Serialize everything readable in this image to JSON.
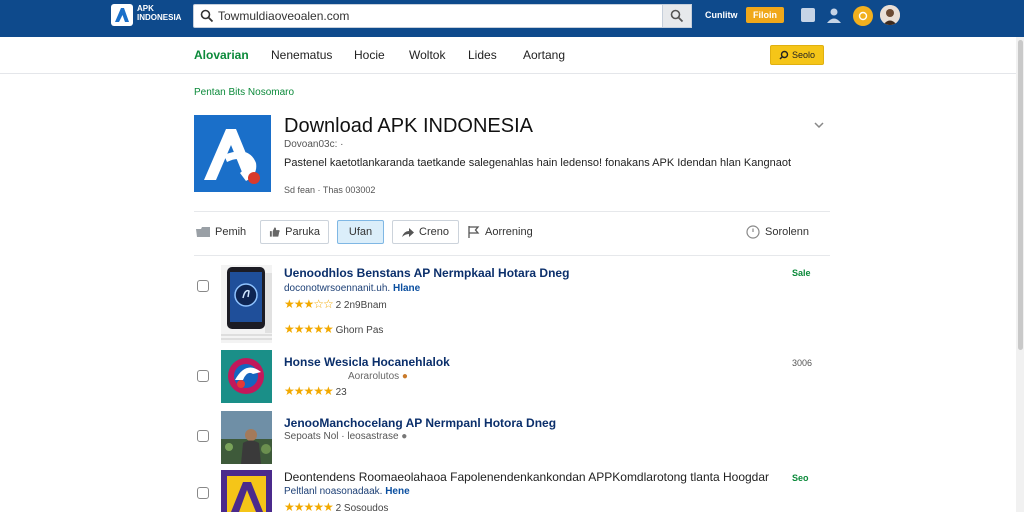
{
  "header": {
    "logo_text": "APK INDONESIA",
    "search_value": "Towmuldiaoveoalen.com",
    "top_link": "Cunlitw",
    "top_button": "Filoin"
  },
  "nav": {
    "items": [
      "Alovarian",
      "Nenematus",
      "Hocie",
      "Woltok",
      "Lides",
      "Aortang"
    ],
    "button_label": "Seolo"
  },
  "breadcrumb": "Pentan Bits Nosomaro",
  "app": {
    "title": "Download APK INDONESIA",
    "subtitle": "Dovoan03c: ·",
    "description": "Pastenel kaetotlankaranda taetkande salegenahlas hain ledenso! fonakans APK Idendan hlan Kangnaot",
    "meta": "Sd fean · Thas 003002"
  },
  "actions": {
    "left": "Pemih",
    "like": "Paruka",
    "active": "Ufan",
    "share": "Creno",
    "report": "Aorrening",
    "right": "Sorolenn"
  },
  "results": [
    {
      "title": "Uenoodhlos Benstans AP Nermpkaal Hotara Dneg",
      "sub": "doconotwrsoennanit.uh.",
      "sub_bold": "Hlane",
      "rating_text": "2 2n9Bnam",
      "rating_text2": "Ghorn Pas",
      "right": "Sale",
      "right_style": "green"
    },
    {
      "title": "Honse Wesicla Hocanehlalok",
      "sub": "Aorarolutos",
      "sub_bold": "",
      "rating_text": "23",
      "rating_text2": "",
      "right": "3006",
      "right_style": "grey"
    },
    {
      "title": "JenooManchocelang AP Nermpanl Hotora Dneg",
      "sub": "Sepoats Nol · leosastrase",
      "sub_bold": "",
      "rating_text": "",
      "rating_text2": "",
      "right": "",
      "right_style": "grey"
    },
    {
      "title": "Deontendens Roomaeolahaoa Fapolenendenkankondan APPKomdlarotong tlanta Hoogdar",
      "sub": "Peltlanl noasonadaak.",
      "sub_bold": "Hene",
      "rating_text": "2 Sosoudos",
      "rating_text2": "",
      "right": "Seo",
      "right_style": "green"
    }
  ],
  "colors": {
    "topbar": "#0e4a8c",
    "accent_green": "#0b8a3a",
    "accent_yellow": "#f5c518",
    "link_blue": "#0b2f6b"
  }
}
